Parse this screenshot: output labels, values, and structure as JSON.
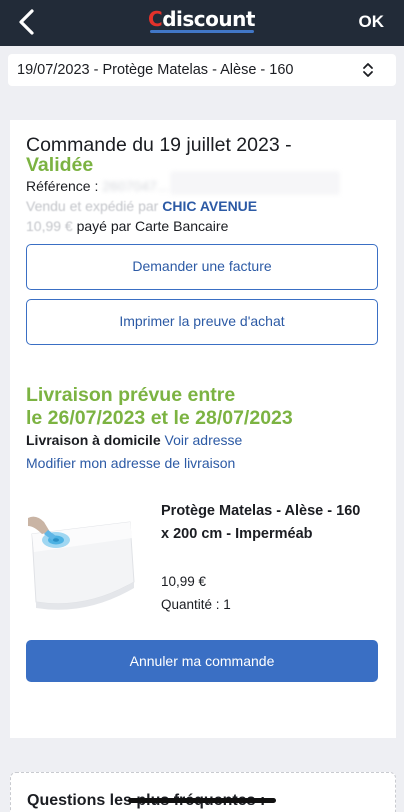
{
  "header": {
    "logo_first": "C",
    "logo_rest": "discount",
    "ok_label": "OK"
  },
  "order_select": {
    "value": "19/07/2023 - Protège Matelas - Alèse - 160"
  },
  "order": {
    "title": "Commande du 19 juillet 2023 -",
    "status": "Validée",
    "reference_label": "Référence : ",
    "reference_value": "2607047...",
    "sold_prefix": "Vendu et expédié par ",
    "seller": "CHIC AVENUE",
    "payment_prefix": "10,99 € ",
    "payment": "payé par Carte Bancaire",
    "invoice_button": "Demander une facture",
    "proof_button": "Imprimer la preuve d'achat"
  },
  "delivery": {
    "title_line1": "Livraison prévue entre",
    "title_line2": "le 26/07/2023 et le 28/07/2023",
    "mode": "Livraison à domicile",
    "view_address": "Voir adresse",
    "modify_address": "Modifier mon adresse de livraison"
  },
  "product": {
    "name": "Protège Matelas - Alèse - 160 x 200 cm - Imperméab",
    "price": "10,99 €",
    "quantity": "Quantité : 1"
  },
  "cancel_button": "Annuler ma commande",
  "faq": {
    "title": "Questions les plus fréquentes :"
  },
  "colors": {
    "topbar": "#222b38",
    "brand_red": "#e4322b",
    "link_blue": "#2c5aa5",
    "button_blue": "#3a6fc4",
    "status_green": "#7cb342"
  }
}
